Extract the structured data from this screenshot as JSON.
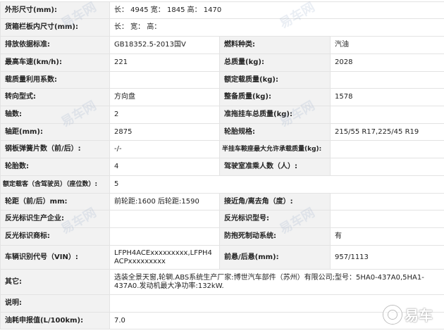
{
  "rows": [
    {
      "l1": "外形尺寸(mm):",
      "v1": "长： 4945 宽： 1845 高： 1470"
    },
    {
      "l1": "货箱栏板内尺寸(mm):",
      "v1": "长： 宽： 高："
    },
    {
      "l1": "排放依据标准:",
      "v1": "GB18352.5-2013国Ⅴ",
      "l2": "燃料种类:",
      "v2": "汽油"
    },
    {
      "l1": "最高车速(km/h):",
      "v1": "221",
      "l2": "总质量(kg):",
      "v2": "2028"
    },
    {
      "l1": "载质量利用系数:",
      "v1": "",
      "l2": "额定载质量(kg):",
      "v2": ""
    },
    {
      "l1": "转向型式:",
      "v1": "方向盘",
      "l2": "整备质量(kg):",
      "v2": "1578"
    },
    {
      "l1": "轴数:",
      "v1": "2",
      "l2": "准拖挂车总质量(kg):",
      "v2": ""
    },
    {
      "l1": "轴距(mm):",
      "v1": "2875",
      "l2": "轮胎规格:",
      "v2": "215/55 R17,225/45 R19"
    },
    {
      "l1": "钢板弹簧片数（前/后）:",
      "v1": "-/-",
      "l2": "半挂车鞍座最大允许承载质量(kg):",
      "v2": ""
    },
    {
      "l1": "轮胎数:",
      "v1": "4",
      "l2": "驾驶室准乘人数（人）:",
      "v2": ""
    },
    {
      "l1": "额定载客（含驾驶员）（座位数）:",
      "v1": "5"
    },
    {
      "l1": "轮距（前/后）mm:",
      "v1": "前轮距:1600 后轮距:1590",
      "l2": "接近角/离去角（度）:",
      "v2": ""
    },
    {
      "l1": "反光标识生产企业:",
      "v1": "",
      "l2": "反光标识型号:",
      "v2": ""
    },
    {
      "l1": "反光标识商标:",
      "v1": "",
      "l2": "防抱死制动系统:",
      "v2": "有"
    },
    {
      "l1": "车辆识别代号（VIN）:",
      "v1": "LFPH4ACExxxxxxxxx,LFPH4ACPxxxxxxxxx",
      "l2": "前悬/后悬(mm):",
      "v2": "957/1113"
    },
    {
      "l1": "其它:",
      "v1": "选装全景天窗,轮辋.ABS系统生产厂家:博世汽车部件（苏州）有限公司;型号：5HA0-437A0,5HA1-437A0.发动机最大净功率:132kW."
    },
    {
      "l1": "说明:",
      "v1": ""
    },
    {
      "l1": "油耗申报值(L/100km):",
      "v1": "7.0"
    }
  ],
  "watermark": {
    "text": "易车网"
  },
  "logo": {
    "text": "易车"
  }
}
